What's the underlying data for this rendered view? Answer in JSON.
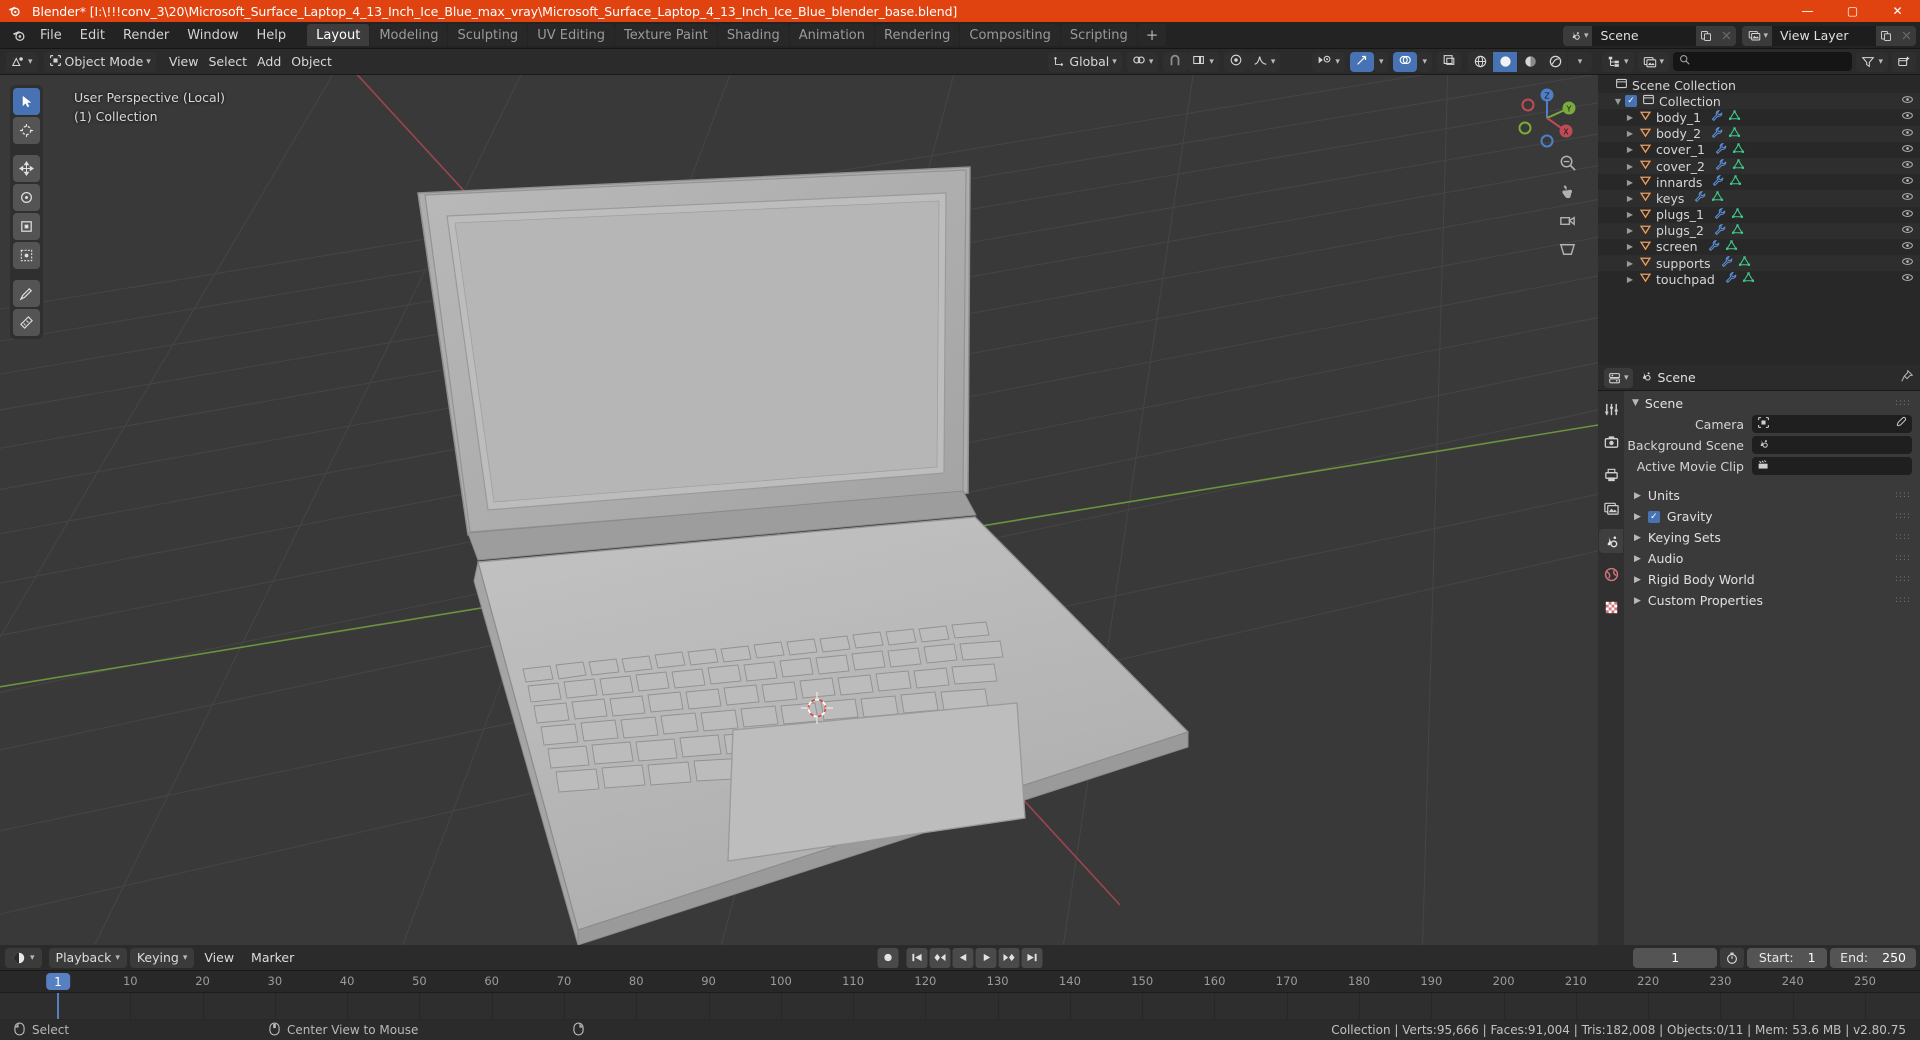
{
  "window": {
    "title": "Blender* [I:\\!!!conv_3\\20\\Microsoft_Surface_Laptop_4_13_Inch_Ice_Blue_max_vray\\Microsoft_Surface_Laptop_4_13_Inch_Ice_Blue_blender_base.blend]",
    "minimize": "—",
    "maximize": "▢",
    "close": "✕",
    "app_icon": "blender-logo-icon"
  },
  "topbar": {
    "menus": [
      "File",
      "Edit",
      "Render",
      "Window",
      "Help"
    ],
    "workspaces": [
      {
        "label": "Layout",
        "active": true
      },
      {
        "label": "Modeling",
        "active": false
      },
      {
        "label": "Sculpting",
        "active": false
      },
      {
        "label": "UV Editing",
        "active": false
      },
      {
        "label": "Texture Paint",
        "active": false
      },
      {
        "label": "Shading",
        "active": false
      },
      {
        "label": "Animation",
        "active": false
      },
      {
        "label": "Rendering",
        "active": false
      },
      {
        "label": "Compositing",
        "active": false
      },
      {
        "label": "Scripting",
        "active": false
      }
    ],
    "add_workspace": "+",
    "scene": {
      "name": "Scene",
      "icon": "scene-icon",
      "new_icon": "duplicate-icon",
      "unlink_icon": "x-icon"
    },
    "view_layer": {
      "name": "View Layer",
      "icon": "view-layer-icon",
      "new_icon": "duplicate-icon",
      "unlink_icon": "x-icon"
    }
  },
  "viewport": {
    "editor_type_icon": "editor-type-3dview-icon",
    "mode": "Object Mode",
    "mode_icon": "object-mode-icon",
    "menus": [
      "View",
      "Select",
      "Add",
      "Object"
    ],
    "transform_orientation": {
      "label": "Global",
      "icon": "orientation-icon"
    },
    "pivot_icon": "pivot-point-icon",
    "snap_icon": "magnet-icon",
    "snap_target_icon": "snap-increment-icon",
    "proportional_icon": "proportional-edit-icon",
    "falloff_icon": "smooth-falloff-icon",
    "visibility_icon": "visibility-eye-icon",
    "gizmo_icon": "gizmo-icon",
    "overlays_icon": "overlays-icon",
    "xray_icon": "xray-icon",
    "shading_modes": [
      {
        "name": "wireframe-shading",
        "active": false
      },
      {
        "name": "solid-shading",
        "active": true
      },
      {
        "name": "material-preview-shading",
        "active": false
      },
      {
        "name": "rendered-shading",
        "active": false
      }
    ],
    "overlay_line1": "User Perspective (Local)",
    "overlay_line2": "(1) Collection",
    "tools": [
      {
        "name": "tweak-select-box-tool",
        "active": true
      },
      {
        "name": "cursor-tool",
        "active": false
      },
      {
        "name": "move-tool",
        "active": false
      },
      {
        "name": "rotate-tool",
        "active": false
      },
      {
        "name": "scale-tool",
        "active": false
      },
      {
        "name": "transform-tool",
        "active": false
      },
      {
        "name": "annotate-tool",
        "active": false
      },
      {
        "name": "measure-tool",
        "active": false
      }
    ],
    "nav_buttons": [
      "zoom-nav-icon",
      "move-nav-icon",
      "camera-nav-icon",
      "perspective-nav-icon"
    ],
    "gizmo_axes": [
      "X",
      "Y",
      "Z"
    ]
  },
  "outliner": {
    "display_mode_icon": "outliner-display-mode-icon",
    "filter_id_icon": "id-type-icon",
    "search_placeholder": "",
    "search_value": "",
    "search_icon": "search-icon",
    "filter_icon": "filter-icon",
    "new_collection_icon": "new-collection-icon",
    "scene_collection": "Scene Collection",
    "collection": {
      "name": "Collection",
      "checked": true,
      "expanded": true
    },
    "objects": [
      {
        "name": "body_1",
        "icon": "mesh-object-icon",
        "modifier": true,
        "mesh_data": true,
        "visible": true
      },
      {
        "name": "body_2",
        "icon": "mesh-object-icon",
        "modifier": true,
        "mesh_data": true,
        "visible": true
      },
      {
        "name": "cover_1",
        "icon": "mesh-object-icon",
        "modifier": true,
        "mesh_data": true,
        "visible": true
      },
      {
        "name": "cover_2",
        "icon": "mesh-object-icon",
        "modifier": true,
        "mesh_data": true,
        "visible": true
      },
      {
        "name": "innards",
        "icon": "mesh-object-icon",
        "modifier": true,
        "mesh_data": true,
        "visible": true
      },
      {
        "name": "keys",
        "icon": "mesh-object-icon",
        "modifier": true,
        "mesh_data": true,
        "visible": true
      },
      {
        "name": "plugs_1",
        "icon": "mesh-object-icon",
        "modifier": true,
        "mesh_data": true,
        "visible": true
      },
      {
        "name": "plugs_2",
        "icon": "mesh-object-icon",
        "modifier": true,
        "mesh_data": true,
        "visible": true
      },
      {
        "name": "screen",
        "icon": "mesh-object-icon",
        "modifier": true,
        "mesh_data": true,
        "visible": true
      },
      {
        "name": "supports",
        "icon": "mesh-object-icon",
        "modifier": true,
        "mesh_data": true,
        "visible": true
      },
      {
        "name": "touchpad",
        "icon": "mesh-object-icon",
        "modifier": true,
        "mesh_data": true,
        "visible": true
      }
    ]
  },
  "properties": {
    "editor_icon": "properties-editor-icon",
    "breadcrumb_icon": "scene-icon",
    "breadcrumb": "Scene",
    "pin_icon": "pin-icon",
    "tabs": [
      {
        "name": "tool-tab",
        "active": false
      },
      {
        "name": "render-tab",
        "active": false
      },
      {
        "name": "output-tab",
        "active": false
      },
      {
        "name": "view-layer-tab",
        "active": false
      },
      {
        "name": "scene-tab",
        "active": true
      },
      {
        "name": "world-tab",
        "active": false
      },
      {
        "name": "texture-tab",
        "active": false
      }
    ],
    "panel_title": "Scene",
    "rows": [
      {
        "label": "Camera",
        "icon": "camera-data-icon",
        "value": "",
        "eyedropper": true
      },
      {
        "label": "Background Scene",
        "icon": "scene-icon",
        "value": "",
        "eyedropper": false
      },
      {
        "label": "Active Movie Clip",
        "icon": "movie-clip-icon",
        "value": "",
        "eyedropper": false
      }
    ],
    "sections": [
      {
        "label": "Units",
        "checkbox": false
      },
      {
        "label": "Gravity",
        "checkbox": true,
        "checked": true
      },
      {
        "label": "Keying Sets",
        "checkbox": false
      },
      {
        "label": "Audio",
        "checkbox": false
      },
      {
        "label": "Rigid Body World",
        "checkbox": false
      },
      {
        "label": "Custom Properties",
        "checkbox": false
      }
    ]
  },
  "timeline": {
    "editor_icon": "timeline-editor-icon",
    "menus": [
      {
        "label": "Playback",
        "dropdown": true
      },
      {
        "label": "Keying",
        "dropdown": true
      },
      {
        "label": "View",
        "dropdown": false
      },
      {
        "label": "Marker",
        "dropdown": false
      }
    ],
    "transport": [
      {
        "name": "record-keyframes-button",
        "glyph": "●"
      },
      {
        "name": "jump-to-start-button",
        "glyph": "◀|"
      },
      {
        "name": "jump-to-prev-keyframe-button",
        "glyph": "◆◀"
      },
      {
        "name": "play-reverse-button",
        "glyph": "◀"
      },
      {
        "name": "play-button",
        "glyph": "▶"
      },
      {
        "name": "jump-to-next-keyframe-button",
        "glyph": "▶◆"
      },
      {
        "name": "jump-to-end-button",
        "glyph": "|▶"
      }
    ],
    "current_frame": "1",
    "use_preview_range_icon": "stopwatch-icon",
    "start_label": "Start:",
    "start_value": "1",
    "end_label": "End:",
    "end_value": "250",
    "ruler_ticks": [
      "1",
      "10",
      "20",
      "30",
      "40",
      "50",
      "60",
      "70",
      "80",
      "90",
      "100",
      "110",
      "120",
      "130",
      "140",
      "150",
      "160",
      "170",
      "180",
      "190",
      "200",
      "210",
      "220",
      "230",
      "240",
      "250"
    ],
    "playhead_frame": "1"
  },
  "statusbar": {
    "left_items": [
      {
        "icon": "mouse-left-icon",
        "label": "Select"
      },
      {
        "icon": "mouse-middle-icon",
        "label": "Center View to Mouse"
      },
      {
        "icon": "mouse-right-icon",
        "label": ""
      }
    ],
    "stats": "Collection | Verts:95,666 | Faces:91,004 | Tris:182,008 | Objects:0/11 | Mem: 53.6 MB | v2.80.75"
  },
  "colors": {
    "title_bar": "#e04310",
    "accent_blue": "#4772b3",
    "viewport_bg": "#393939",
    "editor_bg": "#282828",
    "object_orange": "#ed9e5c",
    "mesh_green": "#41c98a"
  }
}
